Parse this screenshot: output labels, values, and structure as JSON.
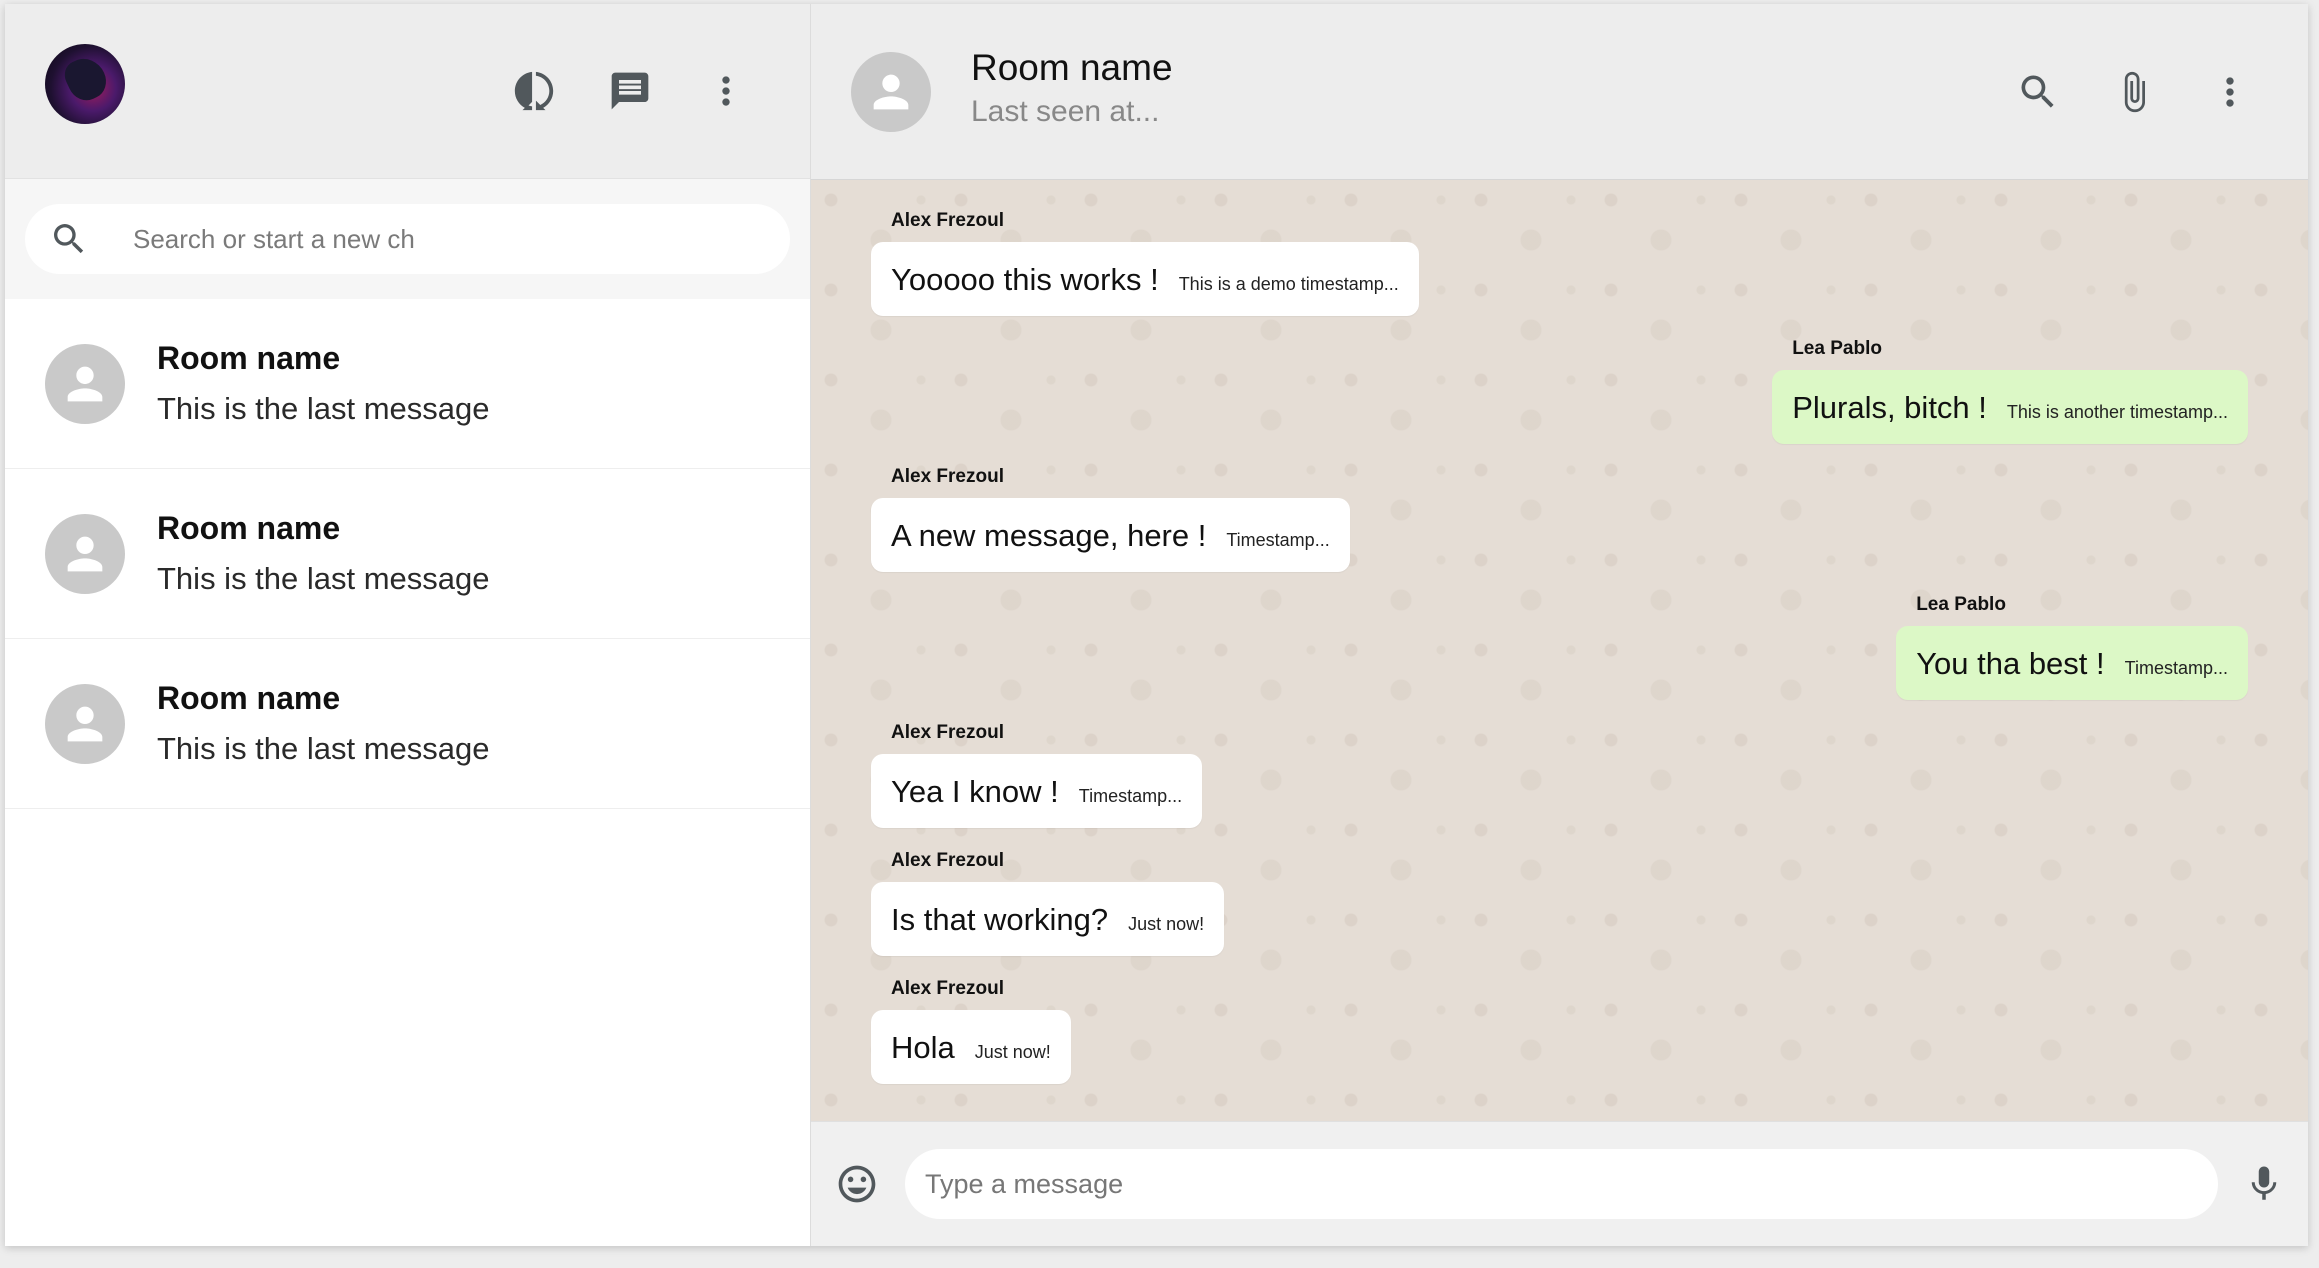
{
  "sidebar": {
    "header": {
      "icons": [
        "status-icon",
        "new-chat-icon",
        "more-vert-icon"
      ]
    },
    "search": {
      "placeholder": "Search or start a new ch"
    },
    "chats": [
      {
        "name": "Room name",
        "last_message": "This is the last message"
      },
      {
        "name": "Room name",
        "last_message": "This is the last message"
      },
      {
        "name": "Room name",
        "last_message": "This is the last message"
      }
    ]
  },
  "chat": {
    "header": {
      "room_name": "Room name",
      "last_seen": "Last seen at..."
    },
    "messages": [
      {
        "sender": "Alex Frezoul",
        "text": "Yooooo this works !",
        "time": "This is a demo timestamp...",
        "direction": "received"
      },
      {
        "sender": "Lea Pablo",
        "text": "Plurals, bitch !",
        "time": "This is another timestamp...",
        "direction": "sent"
      },
      {
        "sender": "Alex Frezoul",
        "text": "A new message, here !",
        "time": "Timestamp...",
        "direction": "received"
      },
      {
        "sender": "Lea Pablo",
        "text": "You tha best !",
        "time": "Timestamp...",
        "direction": "sent"
      },
      {
        "sender": "Alex Frezoul",
        "text": "Yea I know !",
        "time": "Timestamp...",
        "direction": "received"
      },
      {
        "sender": "Alex Frezoul",
        "text": "Is that working?",
        "time": "Just now!",
        "direction": "received"
      },
      {
        "sender": "Alex Frezoul",
        "text": "Hola",
        "time": "Just now!",
        "direction": "received"
      }
    ],
    "footer": {
      "placeholder": "Type a message"
    }
  },
  "colors": {
    "header_bg": "#ededed",
    "chat_bg": "#e5ddd5",
    "sent_bubble": "#dcf8c6",
    "received_bubble": "#ffffff",
    "icon_gray": "#51585c"
  }
}
